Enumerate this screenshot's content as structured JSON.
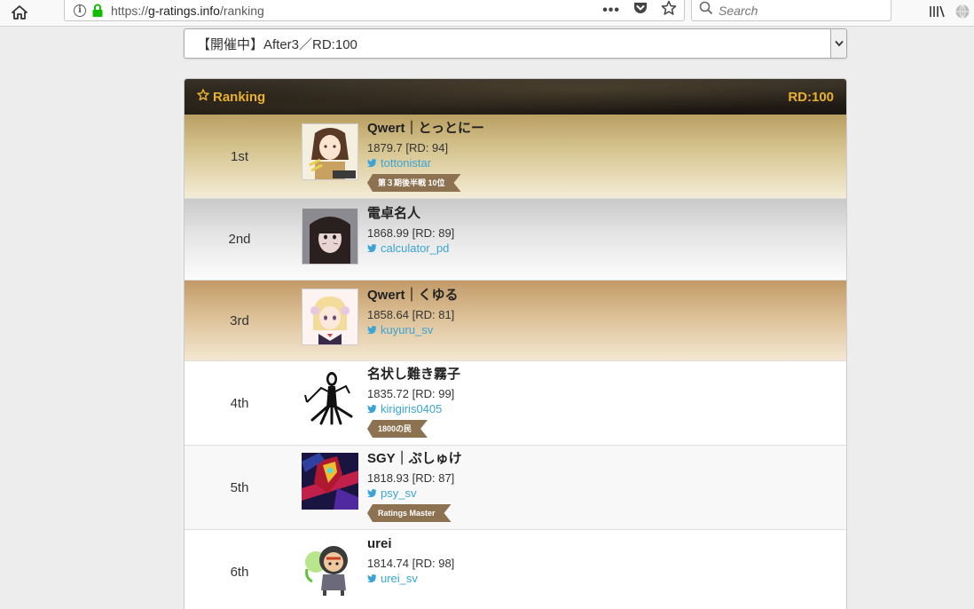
{
  "browser": {
    "url_prefix": "https://",
    "url_host": "g-ratings.info",
    "url_path": "/ranking",
    "search_placeholder": "Search",
    "menu_dots": "•••"
  },
  "selector": {
    "selected": "【開催中】After3／RD:100"
  },
  "ranking": {
    "title": "Ranking",
    "rd_label": "RD:100",
    "accent_color": "#e8b130",
    "rows": [
      {
        "rank": "1st",
        "name": "Qwert｜とっとにー",
        "rating": "1879.7 [RD: 94]",
        "twitter": "tottonistar",
        "badge": "第３期後半戦 10位"
      },
      {
        "rank": "2nd",
        "name": "電卓名人",
        "rating": "1868.99 [RD: 89]",
        "twitter": "calculator_pd"
      },
      {
        "rank": "3rd",
        "name": "Qwert｜くゆる",
        "rating": "1858.64 [RD: 81]",
        "twitter": "kuyuru_sv"
      },
      {
        "rank": "4th",
        "name": "名状し難き霧子",
        "rating": "1835.72 [RD: 99]",
        "twitter": "kirigiris0405",
        "badge": "1800の民"
      },
      {
        "rank": "5th",
        "name": "SGY｜ぷしゅけ",
        "rating": "1818.93 [RD: 87]",
        "twitter": "psy_sv",
        "badge": "Ratings Master"
      },
      {
        "rank": "6th",
        "name": "urei",
        "rating": "1814.74 [RD: 98]",
        "twitter": "urei_sv"
      }
    ]
  }
}
